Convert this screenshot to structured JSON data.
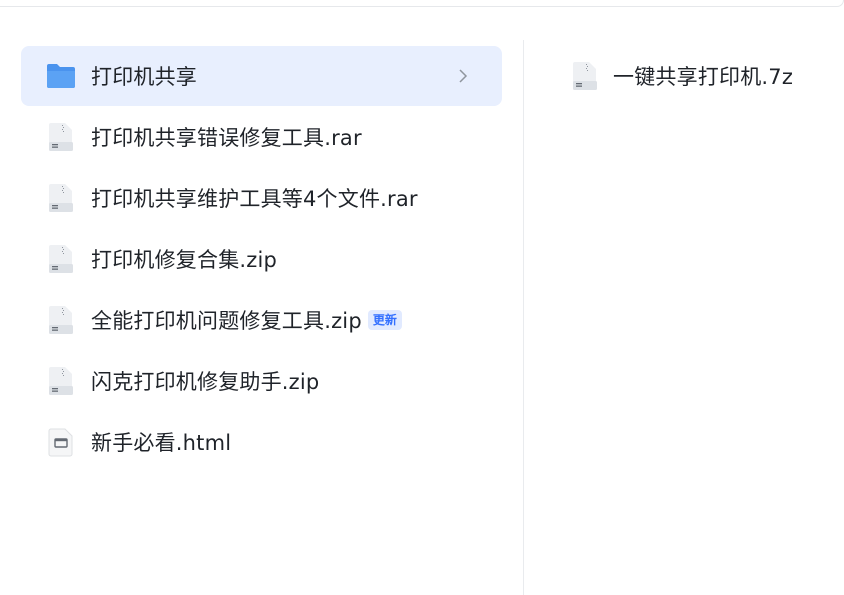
{
  "left_list": {
    "items": [
      {
        "label": "打印机共享",
        "icon": "folder-icon",
        "selected": true
      },
      {
        "label": "打印机共享错误修复工具.rar",
        "icon": "archive-file-icon"
      },
      {
        "label": "打印机共享维护工具等4个文件.rar",
        "icon": "archive-file-icon"
      },
      {
        "label": "打印机修复合集.zip",
        "icon": "archive-file-icon"
      },
      {
        "label": "全能打印机问题修复工具.zip",
        "icon": "archive-file-icon",
        "badge": "更新"
      },
      {
        "label": "闪克打印机修复助手.zip",
        "icon": "archive-file-icon"
      },
      {
        "label": "新手必看.html",
        "icon": "html-file-icon"
      }
    ]
  },
  "right_list": {
    "items": [
      {
        "label": "一键共享打印机.7z",
        "icon": "archive-file-icon"
      }
    ]
  },
  "colors": {
    "selected_background": "#e8effe",
    "folder": "#5ba2f4",
    "badge_text": "#3370ff",
    "badge_background": "#e1eaff"
  }
}
